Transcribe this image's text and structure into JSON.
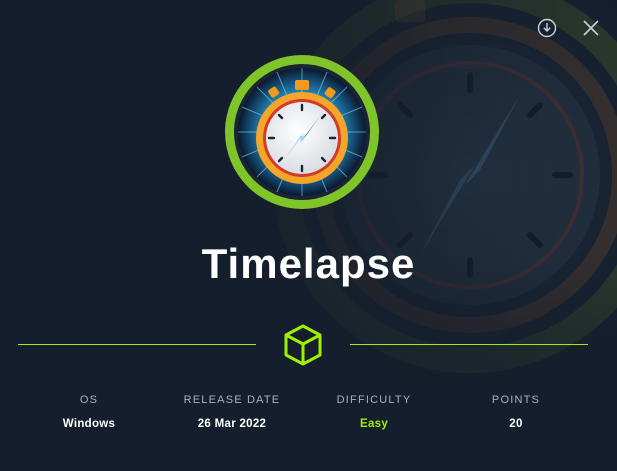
{
  "machine": {
    "name": "Timelapse"
  },
  "stats": [
    {
      "label": "OS",
      "value": "Windows"
    },
    {
      "label": "RELEASE DATE",
      "value": "26 Mar 2022"
    },
    {
      "label": "DIFFICULTY",
      "value": "Easy"
    },
    {
      "label": "POINTS",
      "value": "20"
    }
  ],
  "icons": {
    "download": "download-circle-icon",
    "close": "close-icon",
    "cube": "cube-icon",
    "avatar": "stopwatch-avatar"
  },
  "colors": {
    "background": "#151e2c",
    "accent": "#9fef00",
    "label": "#a4b1cd",
    "text": "#ffffff"
  }
}
